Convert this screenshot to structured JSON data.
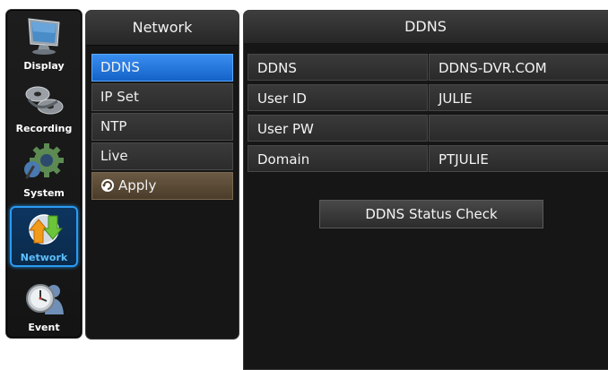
{
  "sidebar": {
    "categories": [
      {
        "label": "Display",
        "icon": "monitor-icon"
      },
      {
        "label": "Recording",
        "icon": "film-reels-icon"
      },
      {
        "label": "System",
        "icon": "gear-icon"
      },
      {
        "label": "Network",
        "icon": "network-arrows-icon",
        "active": true
      },
      {
        "label": "Event",
        "icon": "clock-person-icon"
      }
    ]
  },
  "submenu": {
    "title": "Network",
    "items": [
      {
        "label": "DDNS",
        "selected": true
      },
      {
        "label": "IP Set"
      },
      {
        "label": "NTP"
      },
      {
        "label": "Live"
      }
    ],
    "apply_label": "Apply"
  },
  "panel": {
    "title": "DDNS",
    "fields": [
      {
        "label": "DDNS",
        "value": "DDNS-DVR.COM"
      },
      {
        "label": "User ID",
        "value": "JULIE"
      },
      {
        "label": "User PW",
        "value": ""
      },
      {
        "label": "Domain",
        "value": "PTJULIE"
      }
    ],
    "status_button": "DDNS Status Check"
  },
  "colors": {
    "accent": "#2b9bf2",
    "selected_item": "#1f74dc",
    "apply": "#5a4a36",
    "panel_bg": "#161616"
  }
}
